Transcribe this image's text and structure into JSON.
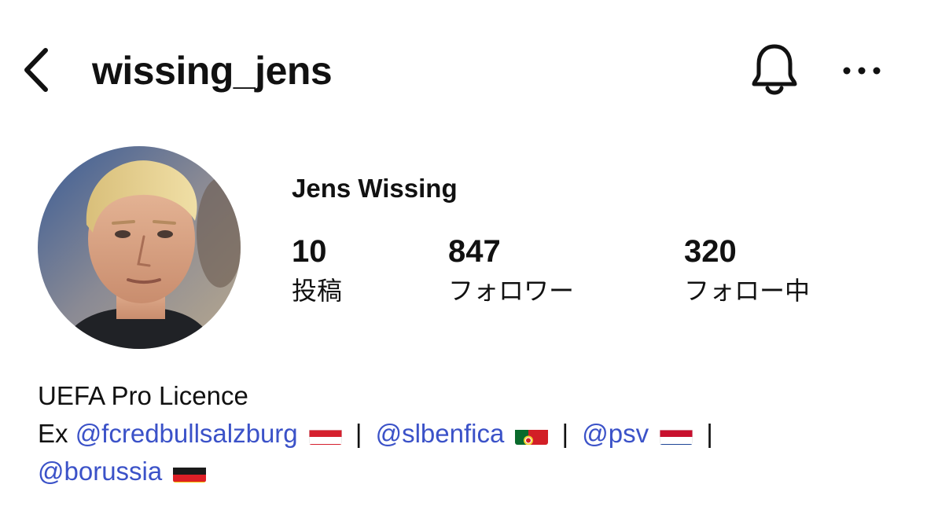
{
  "header": {
    "back_icon": "chevron-left-icon",
    "username": "wissing_jens",
    "bell_icon": "bell-icon",
    "more_icon": "more-horizontal-icon"
  },
  "profile": {
    "display_name": "Jens Wissing",
    "stats": [
      {
        "value": "10",
        "label": "投稿"
      },
      {
        "value": "847",
        "label": "フォロワー"
      },
      {
        "value": "320",
        "label": "フォロー中"
      }
    ]
  },
  "bio": {
    "line1": "UEFA Pro Licence",
    "ex_prefix": "Ex",
    "mentions": [
      "@fcredbullsalzburg",
      "@slbenfica",
      "@psv",
      "@borussia"
    ],
    "separator": "|",
    "flags": [
      "austria-flag",
      "portugal-flag",
      "netherlands-flag",
      "germany-flag"
    ]
  },
  "colors": {
    "text": "#111111",
    "mention": "#3b52c8",
    "background": "#ffffff"
  }
}
